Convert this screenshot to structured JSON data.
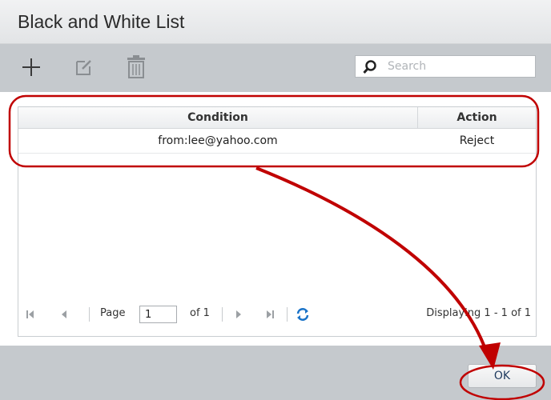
{
  "dialog": {
    "title": "Black and White List"
  },
  "toolbar": {
    "add_icon": "plus-icon",
    "edit_icon": "edit-icon",
    "delete_icon": "trash-icon",
    "search_placeholder": "Search",
    "search_icon": "search-icon"
  },
  "grid": {
    "columns": [
      "Condition",
      "Action"
    ],
    "rows": [
      {
        "condition": "from:lee@yahoo.com",
        "action": "Reject"
      }
    ]
  },
  "pager": {
    "page_label": "Page",
    "page_value": "1",
    "of_label": "of 1",
    "display_label": "Displaying 1 - 1 of 1",
    "refresh_icon": "refresh-icon"
  },
  "footer": {
    "ok_label": "OK"
  },
  "colors": {
    "annotation": "#c00000",
    "refresh": "#1a73c8"
  }
}
